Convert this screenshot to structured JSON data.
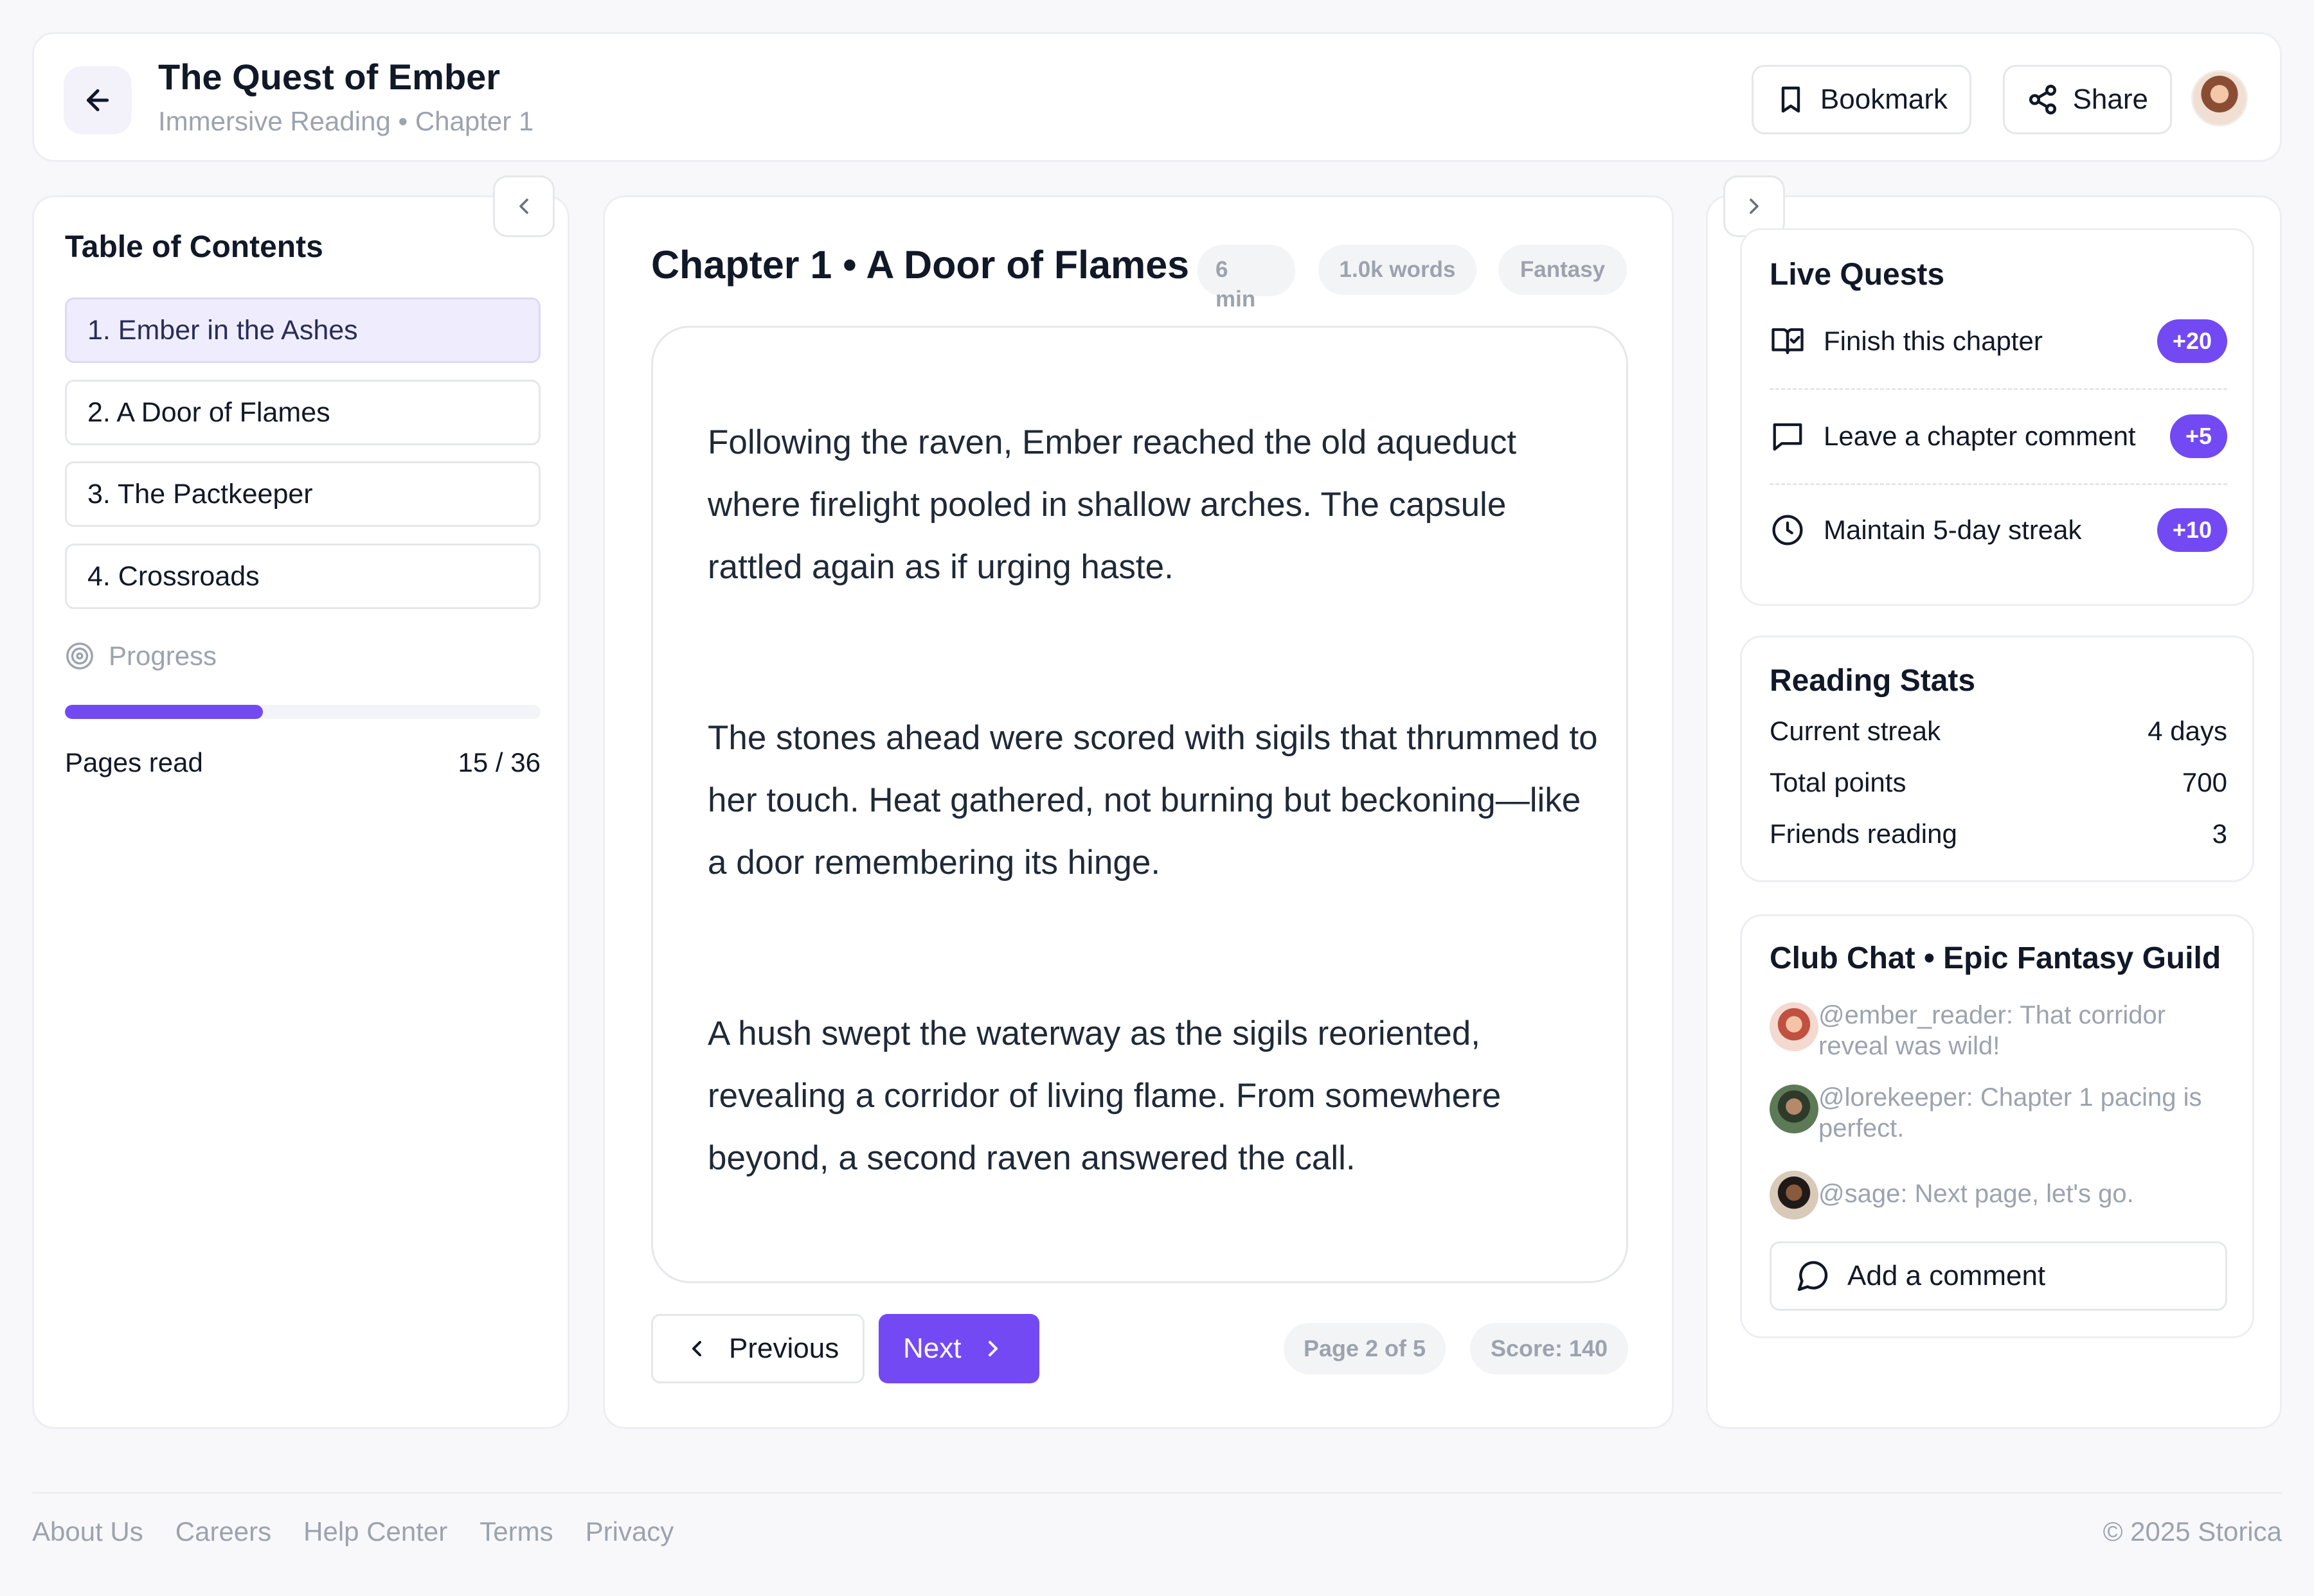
{
  "header": {
    "title": "The Quest of Ember",
    "subtitle": "Immersive Reading • Chapter 1",
    "bookmark_label": "Bookmark",
    "share_label": "Share"
  },
  "toc": {
    "title": "Table of Contents",
    "items": [
      {
        "label": "1. Ember in the Ashes",
        "active": true
      },
      {
        "label": "2. A Door of Flames",
        "active": false
      },
      {
        "label": "3. The Pactkeeper",
        "active": false
      },
      {
        "label": "4. Crossroads",
        "active": false
      }
    ],
    "progress_label": "Progress",
    "progress_fraction": 0.4167,
    "pages_label": "Pages read",
    "pages_value": "15 / 36"
  },
  "reader": {
    "chapter_title": "Chapter 1 • A Door of Flames",
    "pills": [
      "6 min",
      "1.0k words",
      "Fantasy"
    ],
    "paragraphs": [
      "Following the raven, Ember reached the old aqueduct where firelight pooled in shallow arches. The capsule rattled again as if urging haste.",
      "The stones ahead were scored with sigils that thrummed to her touch. Heat gathered, not burning but beckoning—like a door remembering its hinge.",
      "A hush swept the waterway as the sigils reoriented, revealing a corridor of living flame. From somewhere beyond, a second raven answered the call."
    ],
    "prev_label": "Previous",
    "next_label": "Next",
    "page_status": "Page 2 of 5",
    "score": "Score: 140"
  },
  "quests": {
    "title": "Live Quests",
    "items": [
      {
        "icon": "book-check-icon",
        "label": "Finish this chapter",
        "points": "+20"
      },
      {
        "icon": "message-square-icon",
        "label": "Leave a chapter comment",
        "points": "+5"
      },
      {
        "icon": "clock-icon",
        "label": "Maintain 5-day streak",
        "points": "+10"
      }
    ]
  },
  "stats": {
    "title": "Reading Stats",
    "rows": [
      {
        "label": "Current streak",
        "value": "4 days"
      },
      {
        "label": "Total points",
        "value": "700"
      },
      {
        "label": "Friends reading",
        "value": "3"
      }
    ]
  },
  "chat": {
    "title": "Club Chat • Epic Fantasy Guild",
    "messages": [
      {
        "text": "@ember_reader: That corridor reveal was wild!"
      },
      {
        "text": "@lorekeeper: Chapter 1 pacing is perfect."
      },
      {
        "text": "@sage: Next page, let's go."
      }
    ],
    "add_comment_label": "Add a comment"
  },
  "footer": {
    "links": [
      "About Us",
      "Careers",
      "Help Center",
      "Terms",
      "Privacy"
    ],
    "copyright": "© 2025 Storica"
  },
  "colors": {
    "accent": "#7349f3",
    "active_item_bg": "#efedfd",
    "muted_text": "#9ca3af"
  }
}
